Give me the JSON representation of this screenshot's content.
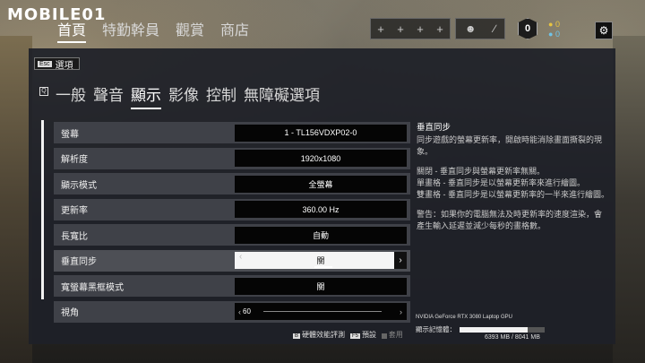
{
  "brand": {
    "logo_text": "MOBILE01"
  },
  "nav": [
    "首頁",
    "特勤幹員",
    "觀賞",
    "商店"
  ],
  "nav_active": 0,
  "squad_slots": [
    "+",
    "+",
    "+",
    "+"
  ],
  "party_icons": [
    "person-icon",
    "slash-icon"
  ],
  "level_badge": "0",
  "currency": {
    "renown": "0",
    "credits": "0",
    "renown_color": "#e8c440",
    "credits_color": "#6fc3e8"
  },
  "back": {
    "key": "Esc",
    "label": "選項"
  },
  "tab_key": "Q",
  "tabs": [
    "一般",
    "聲音",
    "顯示",
    "影像",
    "控制",
    "無障礙選項"
  ],
  "active_tab": 2,
  "settings": [
    {
      "label": "螢幕",
      "value": "1 - TL156VDXP02-0"
    },
    {
      "label": "解析度",
      "value": "1920x1080"
    },
    {
      "label": "顯示模式",
      "value": "全螢幕"
    },
    {
      "label": "更新率",
      "value": "360.00 Hz"
    },
    {
      "label": "長寬比",
      "value": "自動"
    },
    {
      "label": "垂直同步",
      "value": "關",
      "has_arrows": true,
      "selected": true
    },
    {
      "label": "寬螢幕黑框模式",
      "value": "關"
    },
    {
      "label": "視角",
      "value": "60",
      "slider": true
    }
  ],
  "description": {
    "title": "垂直同步",
    "paragraphs": [
      "同步遊戲的螢幕更新率，開啟時能消除畫面撕裂的現象。",
      "關閉 - 垂直同步與螢幕更新率無關。\n單畫格 - 垂直同步是以螢幕更新率來進行繪圖。\n雙畫格 - 垂直同步是以螢幕更新率的一半來進行繪圖。",
      "警告：如果你的電腦無法及時更新率的速度渲染，會產生輸入延遲並減少每秒的畫格數。"
    ]
  },
  "gpu": {
    "name": "NVIDIA GeForce RTX 3080 Laptop GPU",
    "vram_label": "顯示記憶體：",
    "vram_value": "6393 MB / 8041 MB",
    "vram_used_fraction": 0.795
  },
  "footer": [
    {
      "key": "B",
      "label": "硬體效能評測"
    },
    {
      "key": "F5",
      "label": "預設"
    },
    {
      "key": "",
      "label": "套用",
      "disabled": true
    }
  ]
}
